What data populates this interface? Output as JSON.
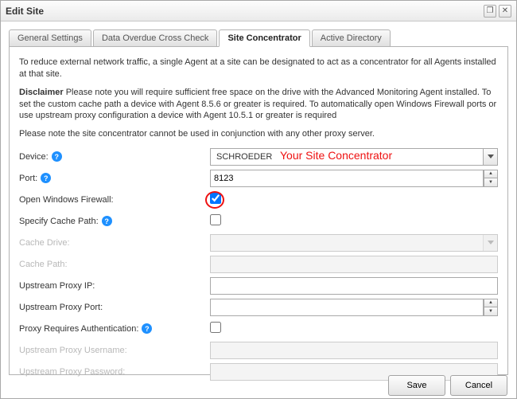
{
  "window": {
    "title": "Edit Site"
  },
  "tabs": [
    {
      "label": "General Settings"
    },
    {
      "label": "Data Overdue Cross Check"
    },
    {
      "label": "Site Concentrator"
    },
    {
      "label": "Active Directory"
    }
  ],
  "intro": "To reduce external network traffic, a single Agent at a site can be designated to act as a concentrator for all Agents installed at that site.",
  "disclaimer_label": "Disclaimer",
  "disclaimer_text": " Please note you will require sufficient free space on the drive with the Advanced Monitoring Agent installed. To set the custom cache path a device with Agent 8.5.6 or greater is required. To automatically open Windows Firewall ports or use upstream proxy configuration a device with Agent 10.5.1 or greater is required",
  "note": "Please note the site concentrator cannot be used in conjunction with any other proxy server.",
  "fields": {
    "device": {
      "label": "Device:",
      "value": "SCHROEDER"
    },
    "port": {
      "label": "Port:",
      "value": "8123"
    },
    "firewall": {
      "label": "Open Windows Firewall:",
      "checked": true
    },
    "cache_path": {
      "label": "Specify Cache Path:",
      "checked": false
    },
    "cache_drive": {
      "label": "Cache Drive:",
      "value": ""
    },
    "cache_path_val": {
      "label": "Cache Path:",
      "value": ""
    },
    "proxy_ip": {
      "label": "Upstream Proxy IP:",
      "value": ""
    },
    "proxy_port": {
      "label": "Upstream Proxy Port:",
      "value": ""
    },
    "proxy_auth": {
      "label": "Proxy Requires Authentication:",
      "checked": false
    },
    "proxy_user": {
      "label": "Upstream Proxy Username:",
      "value": ""
    },
    "proxy_pass": {
      "label": "Upstream Proxy Password:",
      "value": ""
    }
  },
  "annotation": "Your Site Concentrator",
  "buttons": {
    "save": "Save",
    "cancel": "Cancel"
  }
}
